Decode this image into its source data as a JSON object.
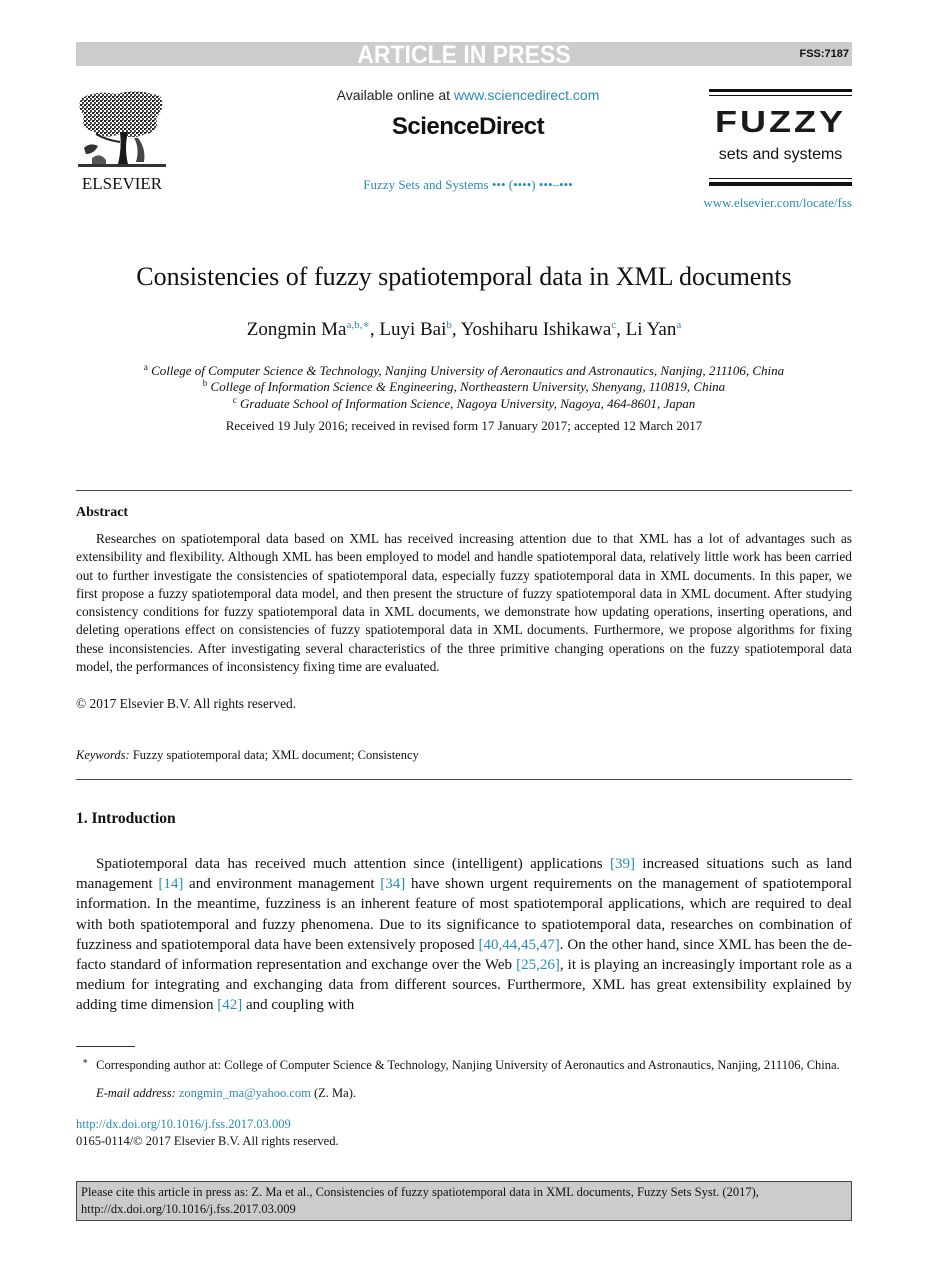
{
  "banner": {
    "title": "ARTICLE IN PRESS",
    "code": "FSS:7187"
  },
  "header": {
    "publisher_logo_text": "ELSEVIER",
    "available_prefix": "Available online at ",
    "available_link": "www.sciencedirect.com",
    "platform_name": "ScienceDirect",
    "journal_reference": "Fuzzy Sets and Systems ••• (••••) •••–•••",
    "journal_logo_word": "FUZZY",
    "journal_logo_subtitle": "sets and systems",
    "journal_url": "www.elsevier.com/locate/fss"
  },
  "article": {
    "title": "Consistencies of fuzzy spatiotemporal data in XML documents",
    "authors": [
      {
        "name": "Zongmin Ma",
        "affil": "a,b,∗",
        "sep": ", "
      },
      {
        "name": "Luyi Bai",
        "affil": "b",
        "sep": ", "
      },
      {
        "name": "Yoshiharu Ishikawa",
        "affil": "c",
        "sep": ", "
      },
      {
        "name": "Li Yan",
        "affil": "a",
        "sep": ""
      }
    ],
    "affiliations": [
      {
        "mark": "a",
        "text": "College of Computer Science & Technology, Nanjing University of Aeronautics and Astronautics, Nanjing, 211106, China"
      },
      {
        "mark": "b",
        "text": "College of Information Science & Engineering, Northeastern University, Shenyang, 110819, China"
      },
      {
        "mark": "c",
        "text": "Graduate School of Information Science, Nagoya University, Nagoya, 464-8601, Japan"
      }
    ],
    "received": "Received 19 July 2016; received in revised form 17 January 2017; accepted 12 March 2017"
  },
  "abstract": {
    "heading": "Abstract",
    "body": "Researches on spatiotemporal data based on XML has received increasing attention due to that XML has a lot of advantages such as extensibility and flexibility. Although XML has been employed to model and handle spatiotemporal data, relatively little work has been carried out to further investigate the consistencies of spatiotemporal data, especially fuzzy spatiotemporal data in XML documents. In this paper, we first propose a fuzzy spatiotemporal data model, and then present the structure of fuzzy spatiotemporal data in XML document. After studying consistency conditions for fuzzy spatiotemporal data in XML documents, we demonstrate how updating operations, inserting operations, and deleting operations effect on consistencies of fuzzy spatiotemporal data in XML documents. Furthermore, we propose algorithms for fixing these inconsistencies. After investigating several characteristics of the three primitive changing operations on the fuzzy spatiotemporal data model, the performances of inconsistency fixing time are evaluated.",
    "copyright": "© 2017 Elsevier B.V. All rights reserved."
  },
  "keywords": {
    "label": "Keywords:",
    "text": " Fuzzy spatiotemporal data; XML document; Consistency"
  },
  "introduction": {
    "heading": "1.  Introduction",
    "segments": [
      {
        "t": "Spatiotemporal data has received much attention since (intelligent) applications "
      },
      {
        "t": "[39]",
        "link": true
      },
      {
        "t": " increased situations such as land management "
      },
      {
        "t": "[14]",
        "link": true
      },
      {
        "t": " and environment management "
      },
      {
        "t": "[34]",
        "link": true
      },
      {
        "t": " have shown urgent requirements on the management of spatiotemporal information. In the meantime, fuzziness is an inherent feature of most spatiotemporal applications, which are required to deal with both spatiotemporal and fuzzy phenomena. Due to its significance to spatiotemporal data, researches on combination of fuzziness and spatiotemporal data have been extensively proposed "
      },
      {
        "t": "[40,44,45,47]",
        "link": true
      },
      {
        "t": ". On the other hand, since XML has been the de-facto standard of information representation and exchange over the Web "
      },
      {
        "t": "[25,26]",
        "link": true
      },
      {
        "t": ", it is playing an increasingly important role as a medium for integrating and exchanging data from dif­ferent sources. Furthermore, XML has great extensibility explained by adding time dimension "
      },
      {
        "t": "[42]",
        "link": true
      },
      {
        "t": " and coupling with"
      }
    ]
  },
  "footnotes": {
    "star": "∗",
    "corresponding": "Corresponding author at: College of Computer Science & Technology, Nanjing University of Aeronautics and Astronautics, Nanjing, 211106, China.",
    "email_label": "E-mail address:",
    "email": "zongmin_ma@yahoo.com",
    "email_suffix": " (Z. Ma).",
    "doi": "http://dx.doi.org/10.1016/j.fss.2017.03.009",
    "issn": "0165-0114/© 2017 Elsevier B.V. All rights reserved."
  },
  "citation": {
    "line1": "Please cite this article in press as: Z. Ma et al., Consistencies of fuzzy spatiotemporal data in XML documents, Fuzzy Sets Syst. (2017),",
    "line2": "http://dx.doi.org/10.1016/j.fss.2017.03.009"
  },
  "colors": {
    "link": "#2a8ab8",
    "banner_bg": "#cccccc"
  }
}
